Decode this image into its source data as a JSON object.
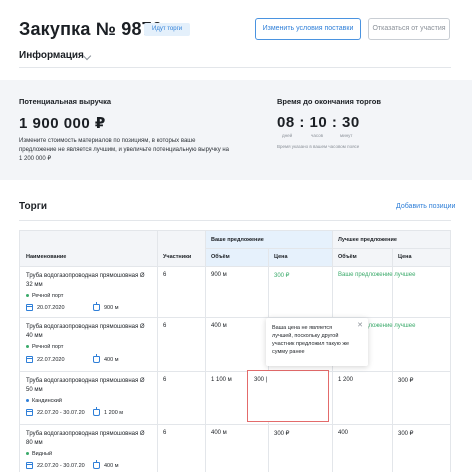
{
  "header": {
    "title": "Закупка № 9876",
    "status": "Идут торги",
    "btn_change": "Изменить условия поставки",
    "btn_decline": "Отказаться от участия",
    "info_tab": "Информация"
  },
  "summary": {
    "revenue_label": "Потенциальная выручка",
    "revenue_value": "1 900 000 ₽",
    "revenue_desc": "Измените стоимость материалов по позициям, в которых ваше предложение не является лучшим, и увеличьте потенциальную выручку на 1 200 000 ₽",
    "timer_label": "Время до окончания торгов",
    "timer_value": "08 : 10 : 30",
    "unit_days": "дней",
    "unit_hours": "часов",
    "unit_minutes": "минут",
    "tz_note": "Время указано в вашем часовом поясе"
  },
  "bids": {
    "title": "Торги",
    "add_link": "Добавить позиции",
    "headers": {
      "name": "Наименование",
      "participants": "Участники",
      "your_offer": "Ваше предложение",
      "best_offer": "Лучшее предложение",
      "volume": "Объём",
      "price": "Цена"
    },
    "rows": [
      {
        "name": "Труба водогазопроводная прямошовная Ø 32 мм",
        "place": "Речной порт",
        "date": "20.07.2020",
        "qty": "900 м",
        "participants": "6",
        "your_volume": "900 м",
        "your_price": "300 ₽",
        "best_note": "Ваше предложение лучшее"
      },
      {
        "name": "Труба водогазопроводная прямошовная Ø 40 мм",
        "place": "Речной порт",
        "date": "22.07.2020",
        "qty": "400 м",
        "participants": "6",
        "your_volume": "400 м",
        "your_price": "",
        "best_note": "Ваше предложение лучшее"
      },
      {
        "name": "Труба водогазопроводная прямошовная Ø 50 мм",
        "place": "Кандинский",
        "date": "22.07.20 - 30.07.20",
        "qty": "1 200 м",
        "participants": "6",
        "your_volume": "1 100 м",
        "your_price": "300 |",
        "best_volume": "1 200",
        "best_price": "300 ₽"
      },
      {
        "name": "Труба водогазопроводная прямошовная Ø 80 мм",
        "place": "Видный",
        "date": "22.07.20 - 30.07.20",
        "qty": "400 м",
        "participants": "6",
        "your_volume": "400 м",
        "your_price": "300 ₽",
        "best_volume": "400",
        "best_price": "300 ₽"
      }
    ],
    "tooltip": "Ваша цена не является лучшей, поскольку другой участник предложил такую же сумму ранее"
  }
}
